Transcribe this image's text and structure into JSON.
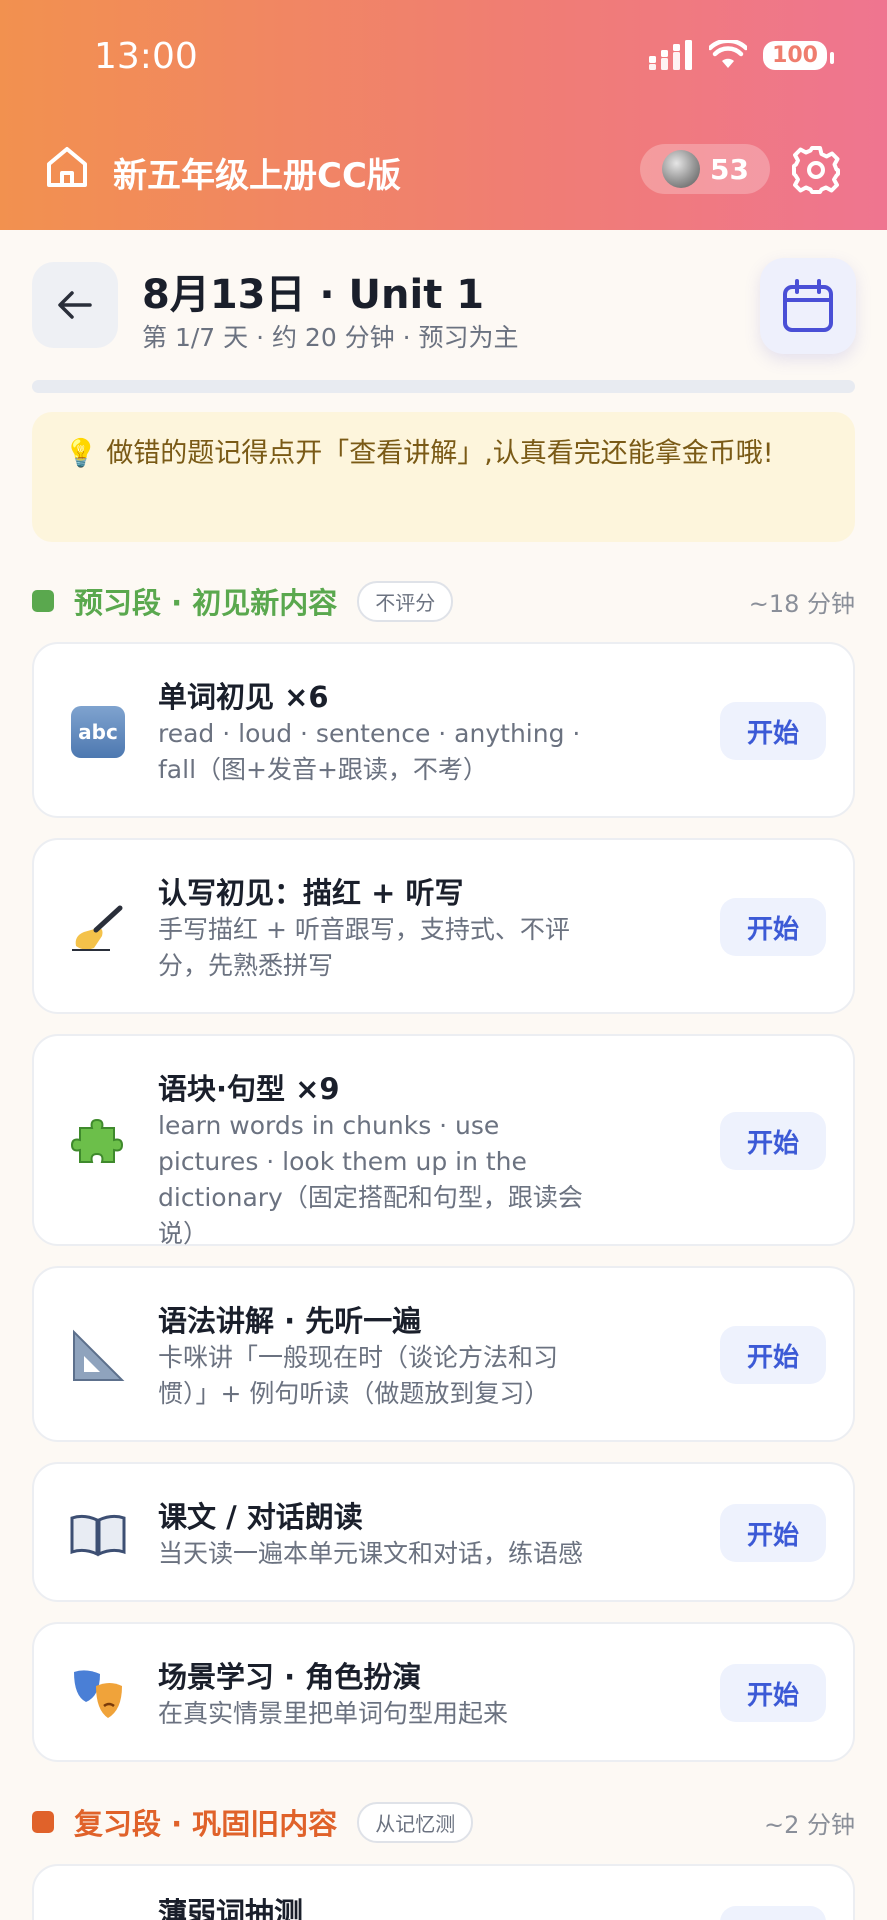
{
  "status_bar": {
    "time": "13:00",
    "battery": "100"
  },
  "header": {
    "title": "新五年级上册CC版",
    "coins": "53"
  },
  "day": {
    "title": "8月13日 · Unit 1",
    "subtitle": "第 1/7 天 · 约 20 分钟 · 预习为主",
    "progress": 0
  },
  "tip": {
    "icon": "lightbulb-icon",
    "text": "💡 做错的题记得点开「查看讲解」,认真看完还能拿金币哦!"
  },
  "sections": [
    {
      "title": "预习段 · 初见新内容",
      "badge": "不评分",
      "duration": "~18 分钟",
      "color": "#5aa84e",
      "cards": [
        {
          "icon": "abc-icon",
          "title": "单词初见 ×6",
          "desc": "read · loud · sentence · anything · fall（图+发音+跟读，不考）",
          "action": "开始"
        },
        {
          "icon": "writing-hand-icon",
          "title": "认写初见：描红 + 听写",
          "desc": "手写描红 + 听音跟写，支持式、不评分，先熟悉拼写",
          "action": "开始"
        },
        {
          "icon": "puzzle-icon",
          "title": "语块·句型 ×9",
          "desc": "learn words in chunks · use pictures · look them up in the dictionary（固定搭配和句型，跟读会说）",
          "action": "开始"
        },
        {
          "icon": "triangle-ruler-icon",
          "title": "语法讲解 · 先听一遍",
          "desc": "卡咪讲「一般现在时（谈论方法和习惯）」+ 例句听读（做题放到复习）",
          "action": "开始"
        },
        {
          "icon": "open-book-icon",
          "title": "课文 / 对话朗读",
          "desc": "当天读一遍本单元课文和对话，练语感",
          "action": "开始"
        },
        {
          "icon": "theater-masks-icon",
          "title": "场景学习 · 角色扮演",
          "desc": "在真实情景里把单词句型用起来",
          "action": "开始"
        }
      ]
    },
    {
      "title": "复习段 · 巩固旧内容",
      "badge": "从记忆测",
      "duration": "~2 分钟",
      "color": "#e0622a",
      "cards": [
        {
          "icon": "pencil-icon",
          "title": "薄弱词抽测",
          "desc": "",
          "action": "开始"
        }
      ]
    }
  ]
}
